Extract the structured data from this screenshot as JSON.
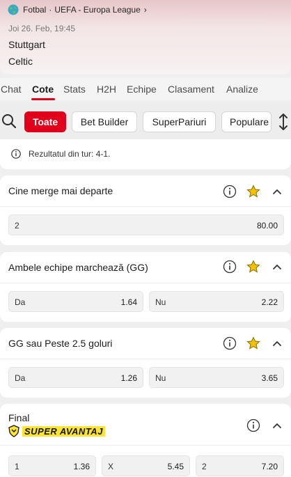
{
  "match": {
    "sport": "Fotbal",
    "competition": "UEFA - Europa League",
    "date": "Joi 26. Feb, 19:45",
    "home": "Stuttgart",
    "away": "Celtic"
  },
  "tabs": [
    "Chat",
    "Cote",
    "Stats",
    "H2H",
    "Echipe",
    "Clasament",
    "Analize"
  ],
  "active_tab": "Cote",
  "filters": [
    "Toate",
    "Bet Builder",
    "SuperPariuri",
    "Populare"
  ],
  "active_filter": "Toate",
  "info": "Rezultatul din tur: 4-1.",
  "markets": [
    {
      "title": "Cine merge mai departe",
      "odds": [
        {
          "label": "2",
          "value": "80.00"
        }
      ]
    },
    {
      "title": "Ambele echipe marchează (GG)",
      "odds": [
        {
          "label": "Da",
          "value": "1.64"
        },
        {
          "label": "Nu",
          "value": "2.22"
        }
      ]
    },
    {
      "title": "GG sau Peste 2.5 goluri",
      "odds": [
        {
          "label": "Da",
          "value": "1.26"
        },
        {
          "label": "Nu",
          "value": "3.65"
        }
      ]
    },
    {
      "title": "Final",
      "badge": "SUPER AVANTAJ",
      "odds": [
        {
          "label": "1",
          "value": "1.36"
        },
        {
          "label": "X",
          "value": "5.45"
        },
        {
          "label": "2",
          "value": "7.20"
        }
      ]
    }
  ],
  "colors": {
    "accent": "#e0001b",
    "favorite": "#f2c200",
    "badge": "#fbe434"
  },
  "icons": [
    "globe-icon",
    "chevron-right-icon",
    "search-icon",
    "sort-icon",
    "info-icon",
    "star-icon",
    "chevron-up-icon",
    "shield-icon"
  ]
}
